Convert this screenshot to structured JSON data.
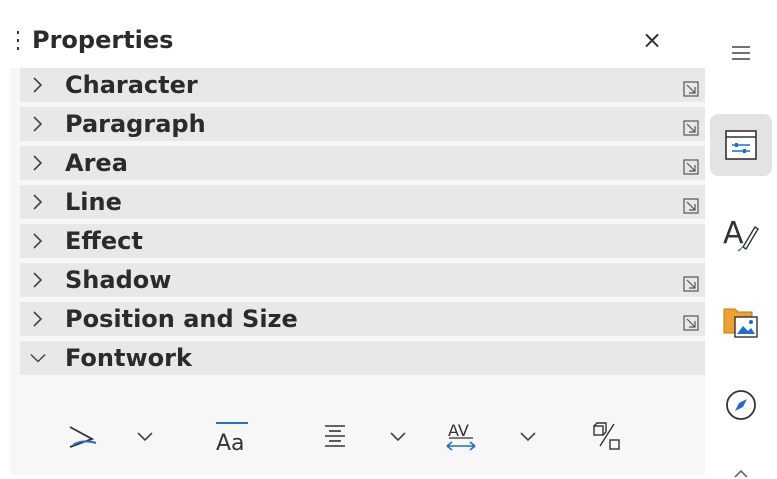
{
  "panel": {
    "title": "Properties",
    "close_label": "×",
    "sections": [
      {
        "label": "Character",
        "expanded": false,
        "has_more_options": true
      },
      {
        "label": "Paragraph",
        "expanded": false,
        "has_more_options": true
      },
      {
        "label": "Area",
        "expanded": false,
        "has_more_options": true
      },
      {
        "label": "Line",
        "expanded": false,
        "has_more_options": true
      },
      {
        "label": "Effect",
        "expanded": false,
        "has_more_options": false
      },
      {
        "label": "Shadow",
        "expanded": false,
        "has_more_options": true
      },
      {
        "label": "Position and Size",
        "expanded": false,
        "has_more_options": true
      },
      {
        "label": "Fontwork",
        "expanded": true,
        "has_more_options": false
      }
    ],
    "fontwork_tools": [
      "fontwork-shape-icon",
      "same-letter-heights-icon",
      "fontwork-alignment-icon",
      "character-spacing-icon",
      "toggle-3d-icon"
    ]
  },
  "sidebar": {
    "menu_icon": "hamburger-menu-icon",
    "tabs": [
      "properties-icon",
      "styles-icon",
      "gallery-icon",
      "navigator-icon"
    ],
    "active_tab": "properties-icon"
  },
  "colors": {
    "accent_blue": "#1e6fc9",
    "gallery_orange": "#f0a030",
    "section_bg": "#e8e8e8"
  }
}
